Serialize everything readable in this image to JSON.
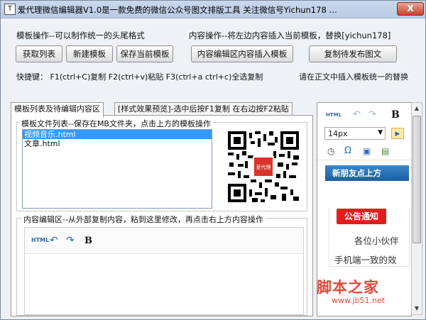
{
  "window": {
    "icon_text": "T",
    "title": "爱代理微信编辑器V1.0是一款免费的微信公众号图文排版工具 关注微信号Yichun178 …",
    "close_label": "X"
  },
  "template_ops": {
    "label": "模板操作--可以制作统一的头尾格式",
    "buttons": [
      "获取列表",
      "新建模板",
      "保存当前模板"
    ]
  },
  "content_ops": {
    "label": "内容操作--将左边内容插入当前模板，替换[yichun178]",
    "insert_button": "内容编辑区内容插入模板",
    "copy_button": "复制待发布图文"
  },
  "hotkeys": {
    "left": "快捷键： F1(ctrl+C)复制  F2(ctrl+v)粘贴 F3(ctrl+a ctrl+c)全选复制",
    "right": "请在正文中插入模板统一的替换"
  },
  "tabs": [
    {
      "label": "模板列表及待编辑内容区",
      "active": true
    },
    {
      "label": "[样式效果预览]-选中后按F1复制 在右边按F2粘贴",
      "active": false
    }
  ],
  "template_list": {
    "legend": "模板文件列表--保存在MB文件夹，点击上方的模板操作",
    "items": [
      {
        "label": "视频音乐.html",
        "selected": true
      },
      {
        "label": "文章.html",
        "selected": false
      }
    ]
  },
  "content_editor": {
    "legend": "内容编辑区--从外部复制内容，粘到这里修改，再点击右上方内容操作",
    "toolbar": {
      "html_label": "HTML",
      "undo": "↶",
      "redo": "↷",
      "bold": "B"
    }
  },
  "right_editor": {
    "toolbar": {
      "html_label": "HTML",
      "bold": "B",
      "font_size": "14px"
    },
    "blue_bar": "新朋友点上方",
    "notice": "公告通知",
    "line1": "各位小伙伴",
    "line2": "手机端一致的效"
  },
  "watermark": {
    "main": "脚本之家",
    "url": "www.jb51.net"
  },
  "qr": {
    "center_text": "爱代理"
  },
  "colors": {
    "accent_blue": "#1d5fa3",
    "notice_red": "#e11d1d",
    "selection": "#3399ff"
  }
}
